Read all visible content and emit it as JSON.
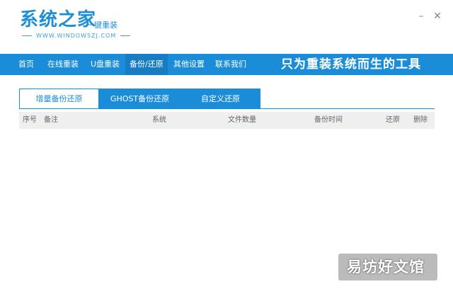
{
  "app": {
    "logo_title": "系统之家",
    "logo_tagline": "一键重装",
    "logo_url_text": "WWW.WINDOWSZJ.COM"
  },
  "window_controls": {
    "minimize": "–",
    "close": "✕"
  },
  "nav": {
    "items": [
      {
        "label": "首页"
      },
      {
        "label": "在线重装"
      },
      {
        "label": "U盘重装"
      },
      {
        "label": "备份/还原",
        "active": true
      },
      {
        "label": "其他设置"
      },
      {
        "label": "联系我们"
      }
    ],
    "slogan": "只为重装系统而生的工具"
  },
  "tabs": [
    {
      "label": "增量备份还原",
      "active": true
    },
    {
      "label": "GHOST备份还原"
    },
    {
      "label": "自定义还原"
    }
  ],
  "table": {
    "columns": [
      "序号",
      "备注",
      "系统",
      "文件数量",
      "备份时间",
      "还原",
      "删除"
    ],
    "rows": []
  },
  "watermark": "易坊好文馆",
  "colors": {
    "accent": "#1b8dd8",
    "accent_dark": "#177cc2",
    "header_bg": "#efefef"
  }
}
